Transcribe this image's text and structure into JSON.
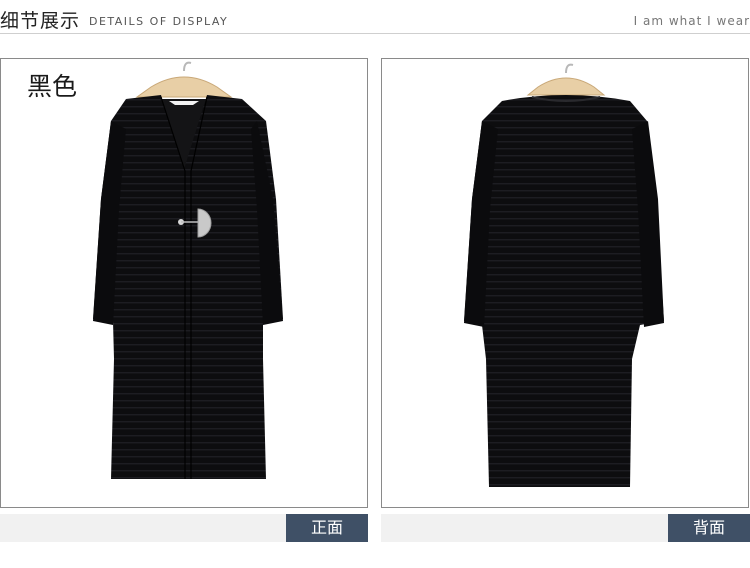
{
  "header": {
    "title_cn": "细节展示",
    "title_en": "DETAILS OF DISPLAY",
    "slogan": "I am what I wear"
  },
  "panels": [
    {
      "color_label": "黑色",
      "caption": "正面",
      "view": "front"
    },
    {
      "color_label": "",
      "caption": "背面",
      "view": "back"
    }
  ],
  "colors": {
    "garment": "#0d0d0f",
    "caption_bg": "#3f5066",
    "hanger": "#e8cfa6"
  }
}
